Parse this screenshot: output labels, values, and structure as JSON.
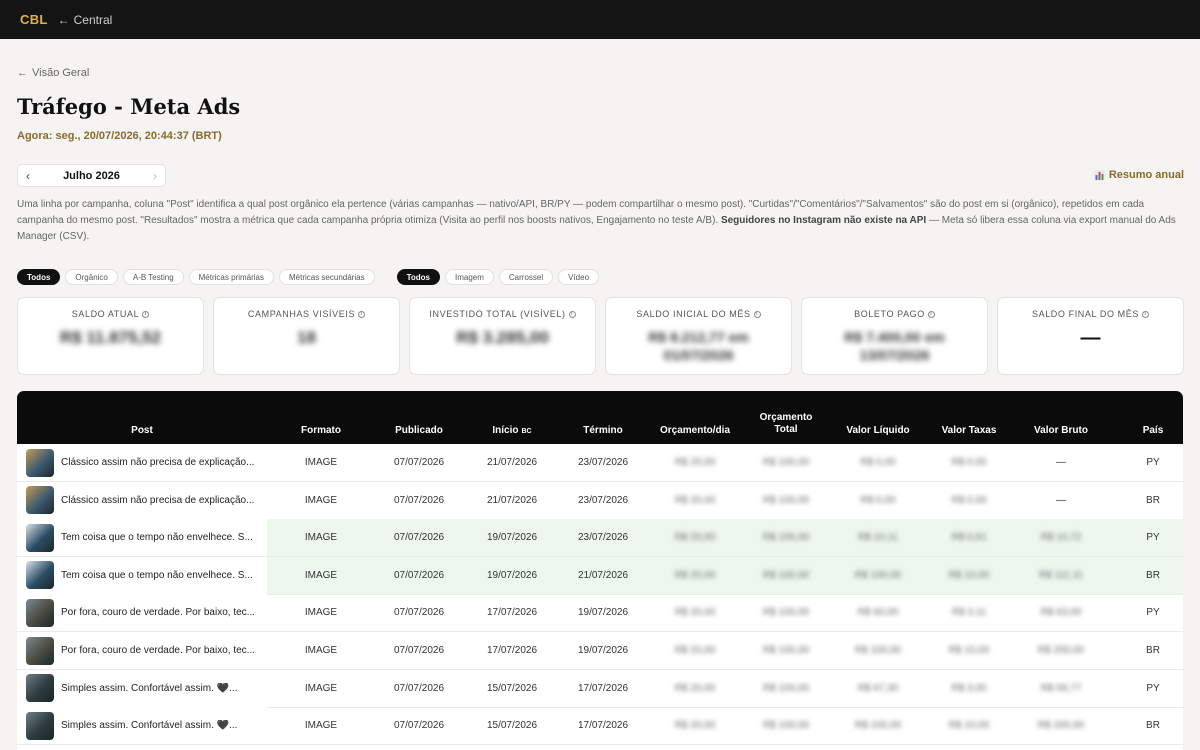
{
  "topbar": {
    "brand": "CBL",
    "back_link": "Central"
  },
  "breadcrumb": {
    "back": "Visão Geral"
  },
  "page": {
    "title": "Tráfego - Meta Ads",
    "now": "Agora: seg., 20/07/2026, 20:44:37 (BRT)"
  },
  "month_nav": {
    "label": "Julho 2026",
    "prev": "‹",
    "next": "›"
  },
  "annual_summary": {
    "label": "Resumo anual",
    "icon": "bar-chart-icon"
  },
  "description": {
    "text_main": "Uma linha por campanha, coluna \"Post\" identifica a qual post orgânico ela pertence (várias campanhas — nativo/API, BR/PY — podem compartilhar o mesmo post). \"Curtidas\"/\"Comentários\"/\"Salvamentos\" são do post em si (orgânico), repetidos em cada campanha do mesmo post. \"Resultados\" mostra a métrica que cada campanha própria otimiza (Visita ao perfil nos boosts nativos, Engajamento no teste A/B). ",
    "text_bold": "Seguidores no Instagram não existe na API",
    "text_tail": " — Meta só libera essa coluna via export manual do Ads Manager (CSV)."
  },
  "filters": {
    "type": [
      "Todos",
      "Orgânico",
      "A-B Testing",
      "Métricas primárias",
      "Métricas secundárias"
    ],
    "format": [
      "Todos",
      "Imagem",
      "Carrossel",
      "Vídeo"
    ],
    "type_active": "Todos",
    "format_active": "Todos"
  },
  "cards": [
    {
      "label": "Saldo atual",
      "value": "R$ 11.875,52"
    },
    {
      "label": "Campanhas visíveis",
      "value": "18"
    },
    {
      "label": "Investido total (visível)",
      "value": "R$ 3.285,00"
    },
    {
      "label": "Saldo inicial do mês",
      "value": "R$ 8.212,77 em",
      "value2": "01/07/2026"
    },
    {
      "label": "Boleto pago",
      "value": "R$ 7.400,00 em",
      "value2": "13/07/2026"
    },
    {
      "label": "Saldo final do mês",
      "value": "—"
    }
  ],
  "table": {
    "headers": {
      "post": "Post",
      "formato": "Formato",
      "publicado": "Publicado",
      "inicio": "Início",
      "inicio_tag": "BC",
      "termino": "Término",
      "orcamento_dia": "Orçamento/dia",
      "orcamento_total_1": "Orçamento",
      "orcamento_total_2": "Total",
      "valor_liquido": "Valor Líquido",
      "valor_taxas": "Valor Taxas",
      "valor_bruto": "Valor Bruto",
      "pais": "País"
    },
    "rows": [
      {
        "post": "Clássico assim não precisa de explicação...",
        "formato": "IMAGE",
        "publicado": "07/07/2026",
        "inicio": "21/07/2026",
        "termino": "23/07/2026",
        "orc_dia": "R$ 20,00",
        "orc_total": "R$ 100,00",
        "liquido": "R$ 0,00",
        "taxas": "R$ 0,00",
        "bruto": "—",
        "pais": "PY"
      },
      {
        "post": "Clássico assim não precisa de explicação...",
        "formato": "IMAGE",
        "publicado": "07/07/2026",
        "inicio": "21/07/2026",
        "termino": "23/07/2026",
        "orc_dia": "R$ 20,00",
        "orc_total": "R$ 100,00",
        "liquido": "R$ 0,00",
        "taxas": "R$ 0,00",
        "bruto": "—",
        "pais": "BR"
      },
      {
        "post": "Tem coisa que o tempo não envelhece. S...",
        "formato": "IMAGE",
        "publicado": "07/07/2026",
        "inicio": "19/07/2026",
        "termino": "23/07/2026",
        "orc_dia": "R$ 20,00",
        "orc_total": "R$ 100,00",
        "liquido": "R$ 10,11",
        "taxas": "R$ 0,61",
        "bruto": "R$ 10,72",
        "pais": "PY"
      },
      {
        "post": "Tem coisa que o tempo não envelhece. S...",
        "formato": "IMAGE",
        "publicado": "07/07/2026",
        "inicio": "19/07/2026",
        "termino": "21/07/2026",
        "orc_dia": "R$ 20,00",
        "orc_total": "R$ 100,00",
        "liquido": "R$ 100,00",
        "taxas": "R$ 10,00",
        "bruto": "R$ 111,11",
        "pais": "BR"
      },
      {
        "post": "Por fora, couro de verdade. Por baixo, tec...",
        "formato": "IMAGE",
        "publicado": "07/07/2026",
        "inicio": "17/07/2026",
        "termino": "19/07/2026",
        "orc_dia": "R$ 20,00",
        "orc_total": "R$ 100,00",
        "liquido": "R$ 60,00",
        "taxas": "R$ 3,11",
        "bruto": "R$ 63,00",
        "pais": "PY"
      },
      {
        "post": "Por fora, couro de verdade. Por baixo, tec...",
        "formato": "IMAGE",
        "publicado": "07/07/2026",
        "inicio": "17/07/2026",
        "termino": "19/07/2026",
        "orc_dia": "R$ 20,00",
        "orc_total": "R$ 100,00",
        "liquido": "R$ 100,00",
        "taxas": "R$ 10,00",
        "bruto": "R$ 200,00",
        "pais": "BR"
      },
      {
        "post": "Simples assim. Confortável assim. 🖤...",
        "formato": "IMAGE",
        "publicado": "07/07/2026",
        "inicio": "15/07/2026",
        "termino": "17/07/2026",
        "orc_dia": "R$ 20,00",
        "orc_total": "R$ 100,00",
        "liquido": "R$ 67,30",
        "taxas": "R$ 3,00",
        "bruto": "R$ 69,77",
        "pais": "PY"
      },
      {
        "post": "Simples assim. Confortável assim. 🖤...",
        "formato": "IMAGE",
        "publicado": "07/07/2026",
        "inicio": "15/07/2026",
        "termino": "17/07/2026",
        "orc_dia": "R$ 20,00",
        "orc_total": "R$ 100,00",
        "liquido": "R$ 100,00",
        "taxas": "R$ 10,00",
        "bruto": "R$ 200,00",
        "pais": "BR"
      }
    ],
    "blurred_columns": [
      "orc_dia",
      "orc_total",
      "liquido",
      "taxas",
      "bruto"
    ],
    "highlight_color": "#edf7ee",
    "highlight_rows": [
      2,
      3
    ]
  },
  "colors": {
    "brand": "#e3b13e",
    "accent": "#8a6a2e",
    "topbar": "#141414",
    "table_header": "#0b0b0b"
  }
}
